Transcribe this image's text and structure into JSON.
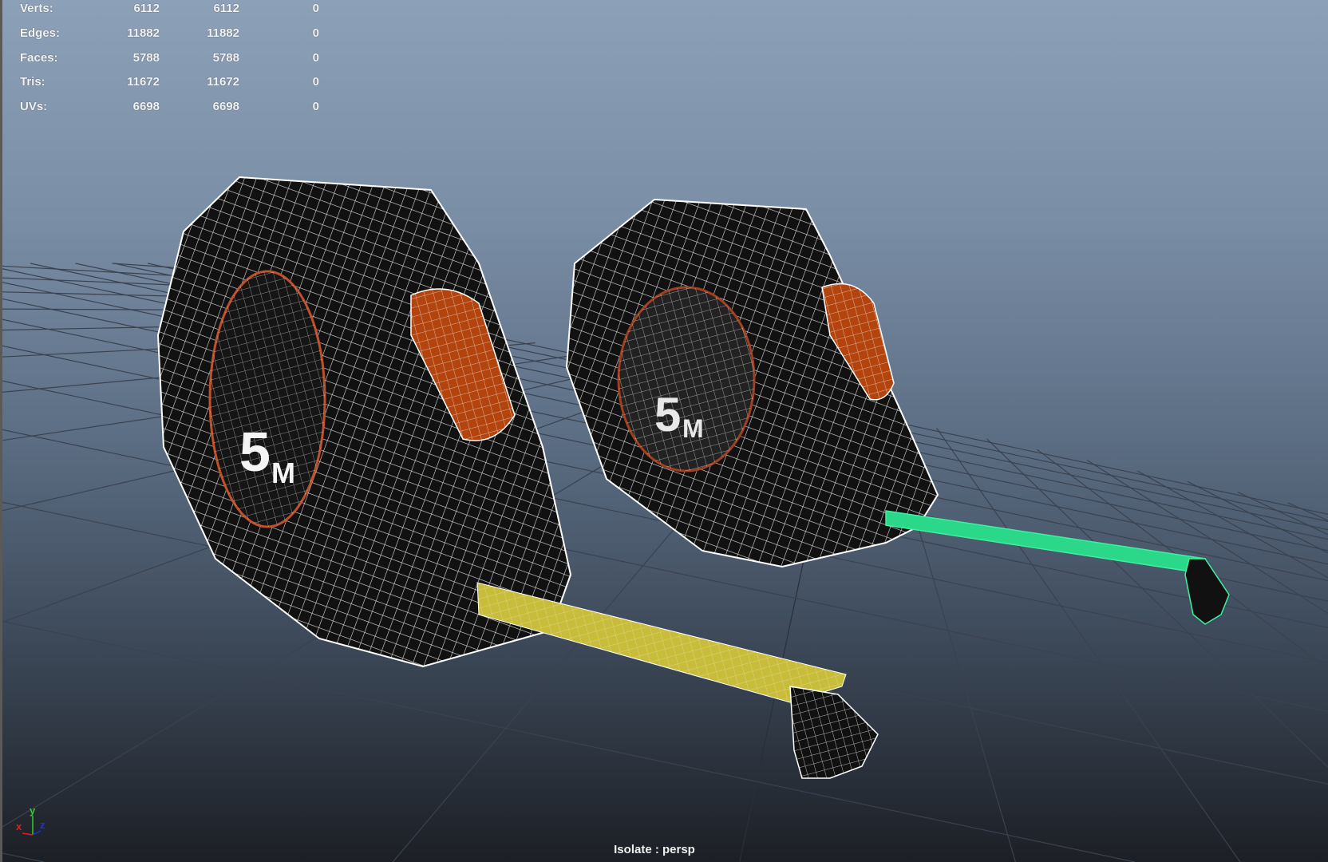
{
  "hud": {
    "rows": [
      {
        "label": "Verts:",
        "v1": "6112",
        "v2": "6112",
        "v3": "0"
      },
      {
        "label": "Edges:",
        "v1": "11882",
        "v2": "11882",
        "v3": "0"
      },
      {
        "label": "Faces:",
        "v1": "5788",
        "v2": "5788",
        "v3": "0"
      },
      {
        "label": "Tris:",
        "v1": "11672",
        "v2": "11672",
        "v3": "0"
      },
      {
        "label": "UVs:",
        "v1": "6698",
        "v2": "6698",
        "v3": "0"
      }
    ]
  },
  "camera_label": "Isolate : persp",
  "axis": {
    "x": "x",
    "y": "y",
    "z": "z"
  },
  "colors": {
    "wire": "#ffffff",
    "body": "#121212",
    "button": "#b8480f",
    "tape": "#c8bd3a",
    "selected": "#3ef0a0"
  }
}
